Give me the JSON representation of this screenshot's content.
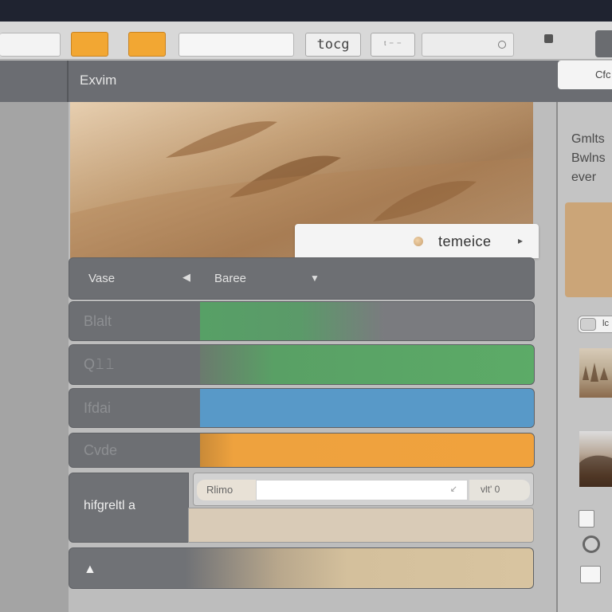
{
  "toolbar": {
    "zoom_label": "tocg",
    "tool_label": "ᵗ ⁻ ⁻"
  },
  "header": {
    "title": "Exvim",
    "button_label": "Cfc"
  },
  "hero": {
    "tooltip_text": "temeice"
  },
  "table": {
    "header": {
      "col1": "Vase",
      "col2": "Baree"
    },
    "rows": [
      {
        "label": "Blalt",
        "color": "#57a066"
      },
      {
        "label": "Q𝚕𝚕",
        "color": "#5cab67"
      },
      {
        "label": "Ifdai",
        "color": "#5899c8"
      },
      {
        "label": "Cvde",
        "color": "#f0a23d"
      }
    ]
  },
  "form_row": {
    "label": "hifgreltl a",
    "input_prefix": "Rlimo",
    "input_suffix": "vlt' 0"
  },
  "right_panel": {
    "title": "Gmlts Bwlns ever",
    "toggle_label": "lc",
    "swatch_color": "#cba578"
  },
  "colors": {
    "accent_orange": "#f2a733",
    "header_gray": "#6b6d72"
  }
}
